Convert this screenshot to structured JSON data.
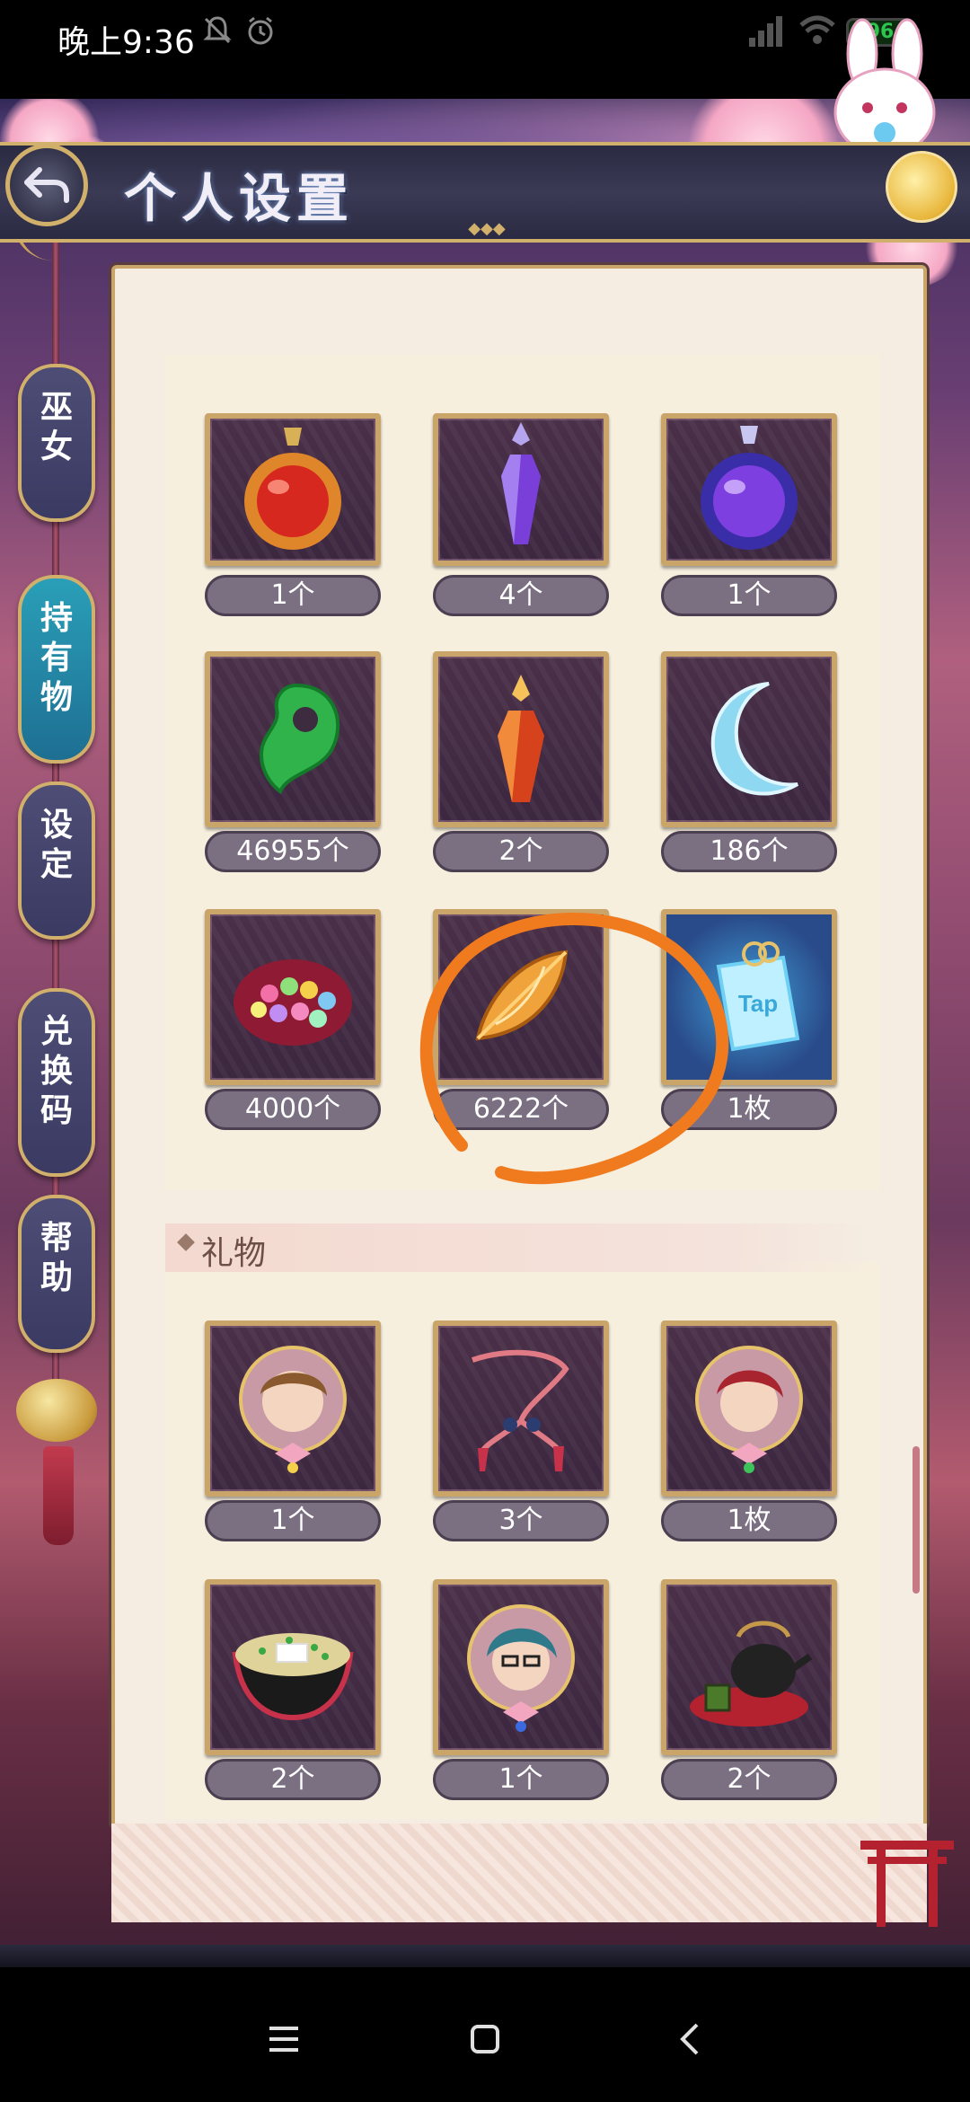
{
  "status_bar": {
    "time": "晚上9:36",
    "battery": "96",
    "icons": [
      "mute-icon",
      "alarm-icon",
      "signal-icon",
      "wifi-icon",
      "battery-icon"
    ]
  },
  "header": {
    "title": "个人设置",
    "back_icon": "back-arrow-icon"
  },
  "side_nav": {
    "items": [
      {
        "label": "巫女",
        "active": false
      },
      {
        "label": "持有物",
        "active": true
      },
      {
        "label": "设定",
        "active": false
      },
      {
        "label": "兑换码",
        "active": false
      },
      {
        "label": "帮助",
        "active": false
      }
    ]
  },
  "items_section": {
    "rows": [
      [
        {
          "icon": "red-potion-icon",
          "count": "1个"
        },
        {
          "icon": "purple-crystal-vial-icon",
          "count": "4个"
        },
        {
          "icon": "blue-potion-icon",
          "count": "1个"
        }
      ],
      [
        {
          "icon": "green-magatama-icon",
          "count": "46955个"
        },
        {
          "icon": "red-crystal-vial-icon",
          "count": "2个"
        },
        {
          "icon": "crescent-moon-icon",
          "count": "186个"
        }
      ],
      [
        {
          "icon": "flower-candy-icon",
          "count": "4000个"
        },
        {
          "icon": "amber-gem-icon",
          "count": "6222个"
        },
        {
          "icon": "tap-charm-icon",
          "count": "1枚",
          "charm_text": "Tap"
        }
      ]
    ]
  },
  "gifts_section": {
    "title": "礼物",
    "rows": [
      [
        {
          "icon": "brown-hair-portrait-icon",
          "count": "1个"
        },
        {
          "icon": "red-cord-tassel-icon",
          "count": "3个"
        },
        {
          "icon": "red-hair-portrait-icon",
          "count": "1枚"
        }
      ],
      [
        {
          "icon": "soup-bowl-icon",
          "count": "2个"
        },
        {
          "icon": "glasses-portrait-icon",
          "count": "1个"
        },
        {
          "icon": "teapot-icon",
          "count": "2个"
        }
      ]
    ]
  },
  "colors": {
    "accent_gold": "#c9a56a",
    "active_tab": "#2a9fb8",
    "annotation": "#f07a1e"
  },
  "nav_bar": {
    "buttons": [
      "menu-icon",
      "home-icon",
      "back-icon"
    ]
  }
}
